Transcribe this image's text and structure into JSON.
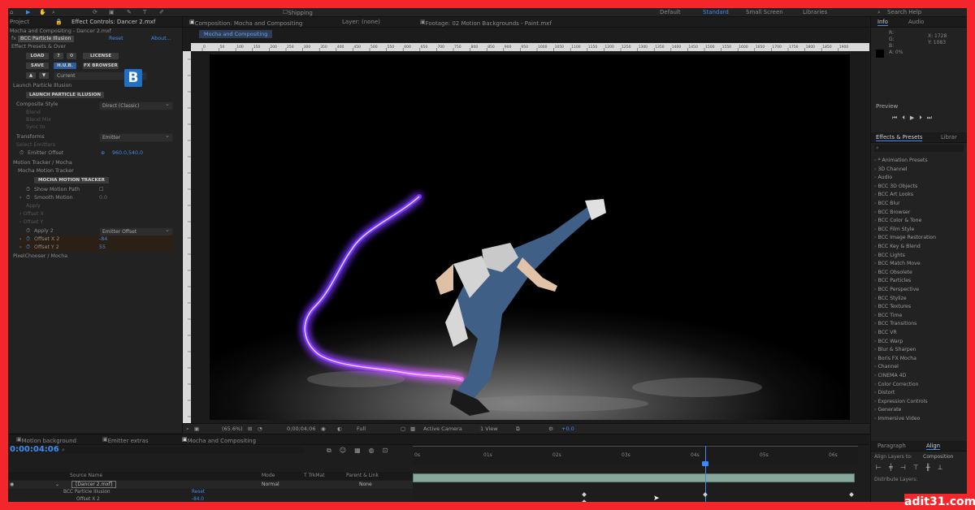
{
  "topbar": {
    "workspace_center": "Shipping",
    "workspaces": [
      "Default",
      "Standard",
      "Small Screen",
      "Libraries"
    ],
    "active_workspace": "Standard",
    "search": "Search Help"
  },
  "left_panel": {
    "tabs": [
      "Project",
      "Effect Controls: Dancer 2.mxf"
    ],
    "breadcrumb": "Mocha and Compositing - Dancer 2.mxf",
    "effect_name": "BCC Particle Illusion",
    "reset": "Reset",
    "about": "About...",
    "effect_presets": "Effect Presets & Over",
    "buttons": {
      "load": "LOAD",
      "help": "?",
      "license": "LICENSE",
      "save": "SAVE",
      "fx_browser": "FX BROWSER",
      "current": "Current",
      "launch": "LAUNCH PARTICLE ILLUSION",
      "mocha_tracker": "MOCHA MOTION TRACKER"
    },
    "section_launch": "Launch Particle Illusion",
    "composite_style_label": "Composite Style",
    "composite_style_value": "Direct (Classic)",
    "transforms_label": "Transforms",
    "transforms_value": "Emitter",
    "emitter_offset_label": "Emitter Offset",
    "emitter_offset_value": "960.0,540.0",
    "section_mocha": "Motion Tracker / Mocha",
    "section_mocha_sub": "Mocha Motion Tracker",
    "show_motion_path": "Show Motion Path",
    "smooth_motion": "Smooth Motion",
    "smooth_value": "0.0",
    "apply_to_label": "Apply 2",
    "apply_to_value": "Emitter Offset",
    "offset_x_label": "Offset X 2",
    "offset_x_value": "-84",
    "offset_y_label": "Offset Y 2",
    "offset_y_value": "55",
    "pixelchooser": "PixelChooser / Mocha"
  },
  "comp_panel": {
    "tabs": [
      "Composition: Mocha and Compositing",
      "Layer: (none)",
      "Footage: 02 Motion Backgrounds - Paint.mxf"
    ],
    "subtab": "Mocha and Compositing",
    "ruler_labels": [
      "0",
      "50",
      "100",
      "150",
      "200",
      "250",
      "300",
      "350",
      "400",
      "450",
      "500",
      "550",
      "600",
      "650",
      "700",
      "750",
      "800",
      "850",
      "900",
      "950",
      "1000",
      "1050",
      "1100",
      "1150",
      "1200",
      "1250",
      "1300",
      "1350",
      "1400",
      "1450",
      "1500",
      "1550",
      "1600",
      "1650",
      "1700",
      "1750",
      "1800",
      "1850",
      "1900"
    ],
    "footer": {
      "zoom": "(65.6%)",
      "timecode": "0;00;04;06",
      "resolution": "Full",
      "camera": "Active Camera",
      "views": "1 View",
      "exposure": "+0.0"
    }
  },
  "right_panel": {
    "info_tab": "Info",
    "audio_tab": "Audio",
    "info_values": {
      "x": "X: 1728",
      "y": "Y: 1083",
      "r": "R:",
      "g": "G:",
      "b": "B:",
      "a": "A: 0%"
    },
    "preview": "Preview",
    "effects_tab": "Effects & Presets",
    "libraries_tab": "Librar",
    "effects": [
      "* Animation Presets",
      "3D Channel",
      "Audio",
      "BCC 3D Objects",
      "BCC Art Looks",
      "BCC Blur",
      "BCC Browser",
      "BCC Color & Tone",
      "BCC Film Style",
      "BCC Image Restoration",
      "BCC Key & Blend",
      "BCC Lights",
      "BCC Match Move",
      "BCC Obsolete",
      "BCC Particles",
      "BCC Perspective",
      "BCC Stylize",
      "BCC Textures",
      "BCC Time",
      "BCC Transitions",
      "BCC VR",
      "BCC Warp",
      "Blur & Sharpen",
      "Boris FX Mocha",
      "Channel",
      "CINEMA 4D",
      "Color Correction",
      "Distort",
      "Expression Controls",
      "Generate",
      "Immersive Video"
    ],
    "paragraph_tab": "Paragraph",
    "align_tab": "Align",
    "align_layers_to": "Align Layers to:",
    "align_target": "Composition",
    "distribute": "Distribute Layers:"
  },
  "timeline": {
    "tabs": [
      "Motion background",
      "Emitter extras",
      "Mocha and Compositing"
    ],
    "timecode": "0:00:04:06",
    "columns": {
      "source_name": "Source Name",
      "mode": "Mode",
      "trkmat": "T TrkMat",
      "parent": "Parent & Link"
    },
    "layer_name": "[Dancer 2.mxf]",
    "layer_mode": "Normal",
    "layer_parent": "None",
    "effect_row": "BCC Particle Illusion",
    "effect_reset": "Reset",
    "offset_row": "Offset X 2",
    "offset_value": "-84.0",
    "time_labels": [
      "0s",
      "01s",
      "02s",
      "03s",
      "04s",
      "05s",
      "06s"
    ]
  },
  "watermark": "adit31.com"
}
